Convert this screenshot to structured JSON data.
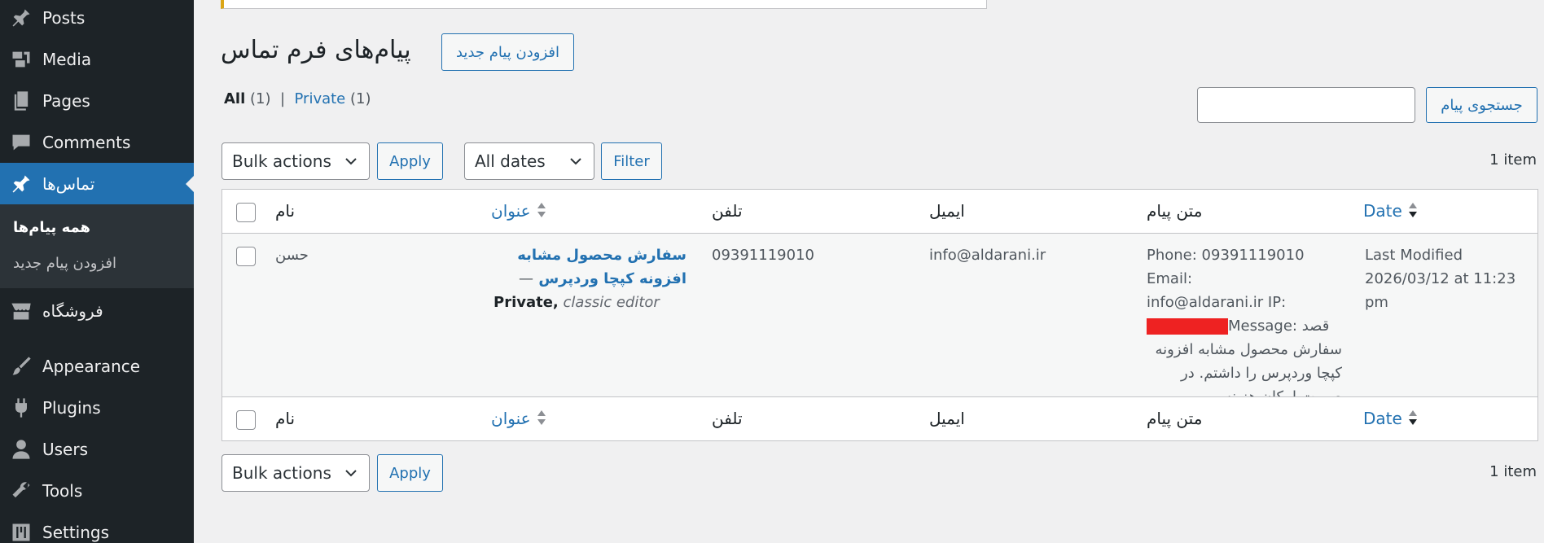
{
  "sidebar": {
    "items": [
      {
        "label": "Posts",
        "icon": "pin-icon"
      },
      {
        "label": "Media",
        "icon": "media-icon"
      },
      {
        "label": "Pages",
        "icon": "pages-icon"
      },
      {
        "label": "Comments",
        "icon": "comments-icon"
      },
      {
        "label": "تماس‌ها",
        "icon": "pin-icon"
      },
      {
        "label": "فروشگاه",
        "icon": "store-icon"
      },
      {
        "label": "Appearance",
        "icon": "paintbrush-icon"
      },
      {
        "label": "Plugins",
        "icon": "plug-icon"
      },
      {
        "label": "Users",
        "icon": "user-icon"
      },
      {
        "label": "Tools",
        "icon": "wrench-icon"
      },
      {
        "label": "Settings",
        "icon": "settings-icon"
      }
    ],
    "submenu": [
      {
        "label": "همه پیام‌ها"
      },
      {
        "label": "افزودن پیام جدید"
      }
    ]
  },
  "header": {
    "title": "پیام‌های فرم تماس",
    "add_new_label": "افزودن پیام جدید"
  },
  "views": {
    "all_label": "All",
    "all_count": "(1)",
    "separator": "|",
    "private_label": "Private",
    "private_count": "(1)"
  },
  "search": {
    "button_label": "جستجوی پیام",
    "value": ""
  },
  "top_nav": {
    "bulk_actions": "Bulk actions",
    "apply_label": "Apply",
    "dates_filter": "All dates",
    "filter_label": "Filter",
    "items_count": "1 item"
  },
  "table": {
    "columns": {
      "name": "نام",
      "title": "عنوان",
      "phone": "تلفن",
      "email": "ایمیل",
      "message": "متن پیام",
      "date": "Date"
    },
    "rows": [
      {
        "name": "حسن",
        "title_line1": "سفارش محصول مشابه",
        "title_line2": "افزونه کپچا وردپرس",
        "title_dash": "—",
        "state_private": "Private,",
        "state_editor": "classic editor",
        "phone": "09391119010",
        "email": "info@aldarani.ir",
        "message_line1": "Phone: 09391119010 Email:",
        "message_line2": "info@aldarani.ir IP:",
        "message_line3": "Message: قصد",
        "message_line4": "سفارش محصول مشابه افزونه",
        "message_line5": "کپچا وردپرس را داشتم. در",
        "message_line6": "صورت امکان هزینه ...",
        "date_line1": "Last Modified",
        "date_line2": "2026/03/12 at 11:23",
        "date_line3": "pm"
      }
    ]
  },
  "bottom_nav": {
    "bulk_actions": "Bulk actions",
    "apply_label": "Apply",
    "items_count": "1 item"
  },
  "colors": {
    "sidebar_bg": "#1d2327",
    "accent": "#2271b1",
    "notice": "#dba617",
    "redaction": "#ee2222"
  }
}
